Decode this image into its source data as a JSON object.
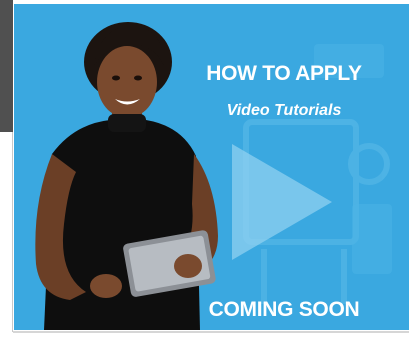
{
  "banner": {
    "title": "HOW TO APPLY",
    "subtitle": "Video Tutorials",
    "cta": "COMING SOON",
    "play_icon": "play-icon",
    "background_color": "#3aa8e0"
  },
  "frame": {
    "left_strip_color": "#505050"
  }
}
